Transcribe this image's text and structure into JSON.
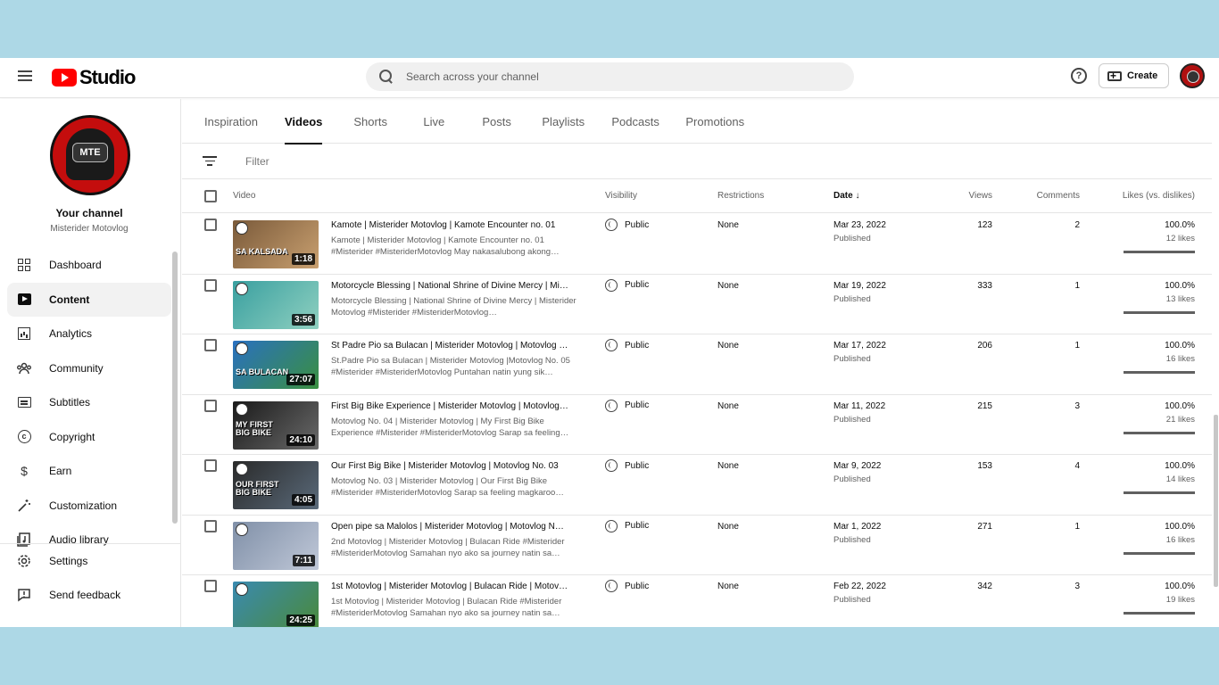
{
  "header": {
    "logo_text": "Studio",
    "search_placeholder": "Search across your channel",
    "help_glyph": "?",
    "create_label": "Create"
  },
  "sidebar": {
    "avatar_text": "MTE",
    "your_channel": "Your channel",
    "channel_name": "Misterider Motovlog",
    "items": [
      {
        "label": "Dashboard",
        "icon": "dashboard-icon"
      },
      {
        "label": "Content",
        "icon": "content-icon",
        "active": true
      },
      {
        "label": "Analytics",
        "icon": "analytics-icon"
      },
      {
        "label": "Community",
        "icon": "community-icon"
      },
      {
        "label": "Subtitles",
        "icon": "subtitles-icon"
      },
      {
        "label": "Copyright",
        "icon": "copyright-icon"
      },
      {
        "label": "Earn",
        "icon": "earn-icon"
      },
      {
        "label": "Customization",
        "icon": "customization-icon"
      },
      {
        "label": "Audio library",
        "icon": "audio-library-icon"
      }
    ],
    "bottom_items": [
      {
        "label": "Settings",
        "icon": "gear-icon"
      },
      {
        "label": "Send feedback",
        "icon": "feedback-icon"
      }
    ],
    "copyright_glyph": "c",
    "earn_glyph": "$"
  },
  "tabs": [
    "Inspiration",
    "Videos",
    "Shorts",
    "Live",
    "Posts",
    "Playlists",
    "Podcasts",
    "Promotions"
  ],
  "active_tab": "Videos",
  "filter_placeholder": "Filter",
  "columns": {
    "video": "Video",
    "visibility": "Visibility",
    "restrictions": "Restrictions",
    "date": "Date ↓",
    "views": "Views",
    "comments": "Comments",
    "likes": "Likes (vs. dislikes)"
  },
  "videos": [
    {
      "title": "Kamote | Misterider Motovlog | Kamote Encounter no. 01",
      "desc": "Kamote | Misterider Motovlog | Kamote Encounter no. 01 #Misterider #MisteriderMotovlog May nakasalubong akong…",
      "duration": "1:18",
      "thumb_text": "SA KALSADA",
      "visibility": "Public",
      "restrictions": "None",
      "date": "Mar 23, 2022",
      "status": "Published",
      "views": "123",
      "comments": "2",
      "likes_pct": "100.0%",
      "likes": "12 likes",
      "like_ratio": 1.0,
      "thumb_colors": [
        "#7a5a3a",
        "#c9a070"
      ]
    },
    {
      "title": "Motorcycle Blessing | National Shrine of Divine Mercy | Mi…",
      "desc": "Motorcycle Blessing | National Shrine of Divine Mercy | Misterider Motovlog #Misterider #MisteriderMotovlog…",
      "duration": "3:56",
      "thumb_text": "",
      "visibility": "Public",
      "restrictions": "None",
      "date": "Mar 19, 2022",
      "status": "Published",
      "views": "333",
      "comments": "1",
      "likes_pct": "100.0%",
      "likes": "13 likes",
      "like_ratio": 1.0,
      "thumb_colors": [
        "#3aa0a0",
        "#8fd0c0"
      ]
    },
    {
      "title": "St Padre Pio sa Bulacan | Misterider Motovlog | Motovlog …",
      "desc": "St.Padre Pio sa Bulacan | Misterider Motovlog |Motovlog No. 05 #Misterider #MisteriderMotovlog Puntahan natin yung sik…",
      "duration": "27:07",
      "thumb_text": "SA BULACAN",
      "visibility": "Public",
      "restrictions": "None",
      "date": "Mar 17, 2022",
      "status": "Published",
      "views": "206",
      "comments": "1",
      "likes_pct": "100.0%",
      "likes": "16 likes",
      "like_ratio": 1.0,
      "thumb_colors": [
        "#2a70c0",
        "#3a9040"
      ]
    },
    {
      "title": "First Big Bike Experience | Misterider Motovlog | Motovlog…",
      "desc": "Motovlog No. 04 | Misterider Motovlog | My First Big Bike Experience #Misterider #MisteriderMotovlog Sarap sa feeling…",
      "duration": "24:10",
      "thumb_text": "MY FIRST BIG BIKE",
      "visibility": "Public",
      "restrictions": "None",
      "date": "Mar 11, 2022",
      "status": "Published",
      "views": "215",
      "comments": "3",
      "likes_pct": "100.0%",
      "likes": "21 likes",
      "like_ratio": 1.0,
      "thumb_colors": [
        "#1a1a1a",
        "#6a6a6a"
      ]
    },
    {
      "title": "Our First Big Bike | Misterider Motovlog | Motovlog No. 03",
      "desc": "Motovlog No. 03 | Misterider Motovlog | Our First Big Bike #Misterider #MisteriderMotovlog Sarap sa feeling magkaroo…",
      "duration": "4:05",
      "thumb_text": "OUR FIRST BIG BIKE",
      "visibility": "Public",
      "restrictions": "None",
      "date": "Mar 9, 2022",
      "status": "Published",
      "views": "153",
      "comments": "4",
      "likes_pct": "100.0%",
      "likes": "14 likes",
      "like_ratio": 1.0,
      "thumb_colors": [
        "#2a2a2a",
        "#5a6a7a"
      ]
    },
    {
      "title": "Open pipe sa Malolos | Misterider Motovlog | Motovlog N…",
      "desc": "2nd Motovlog | Misterider Motovlog | Bulacan Ride #Misterider #MisteriderMotovlog Samahan nyo ako sa journey natin sa…",
      "duration": "7:11",
      "thumb_text": "",
      "visibility": "Public",
      "restrictions": "None",
      "date": "Mar 1, 2022",
      "status": "Published",
      "views": "271",
      "comments": "1",
      "likes_pct": "100.0%",
      "likes": "16 likes",
      "like_ratio": 1.0,
      "thumb_colors": [
        "#8090a8",
        "#c0c8d8"
      ]
    },
    {
      "title": "1st Motovlog | Misterider Motovlog | Bulacan Ride | Motov…",
      "desc": "1st Motovlog | Misterider Motovlog | Bulacan Ride #Misterider #MisteriderMotovlog Samahan nyo ako sa journey natin sa…",
      "duration": "24:25",
      "thumb_text": "",
      "visibility": "Public",
      "restrictions": "None",
      "date": "Feb 22, 2022",
      "status": "Published",
      "views": "342",
      "comments": "3",
      "likes_pct": "100.0%",
      "likes": "19 likes",
      "like_ratio": 1.0,
      "thumb_colors": [
        "#3a8ab0",
        "#4a8a3a"
      ]
    }
  ]
}
